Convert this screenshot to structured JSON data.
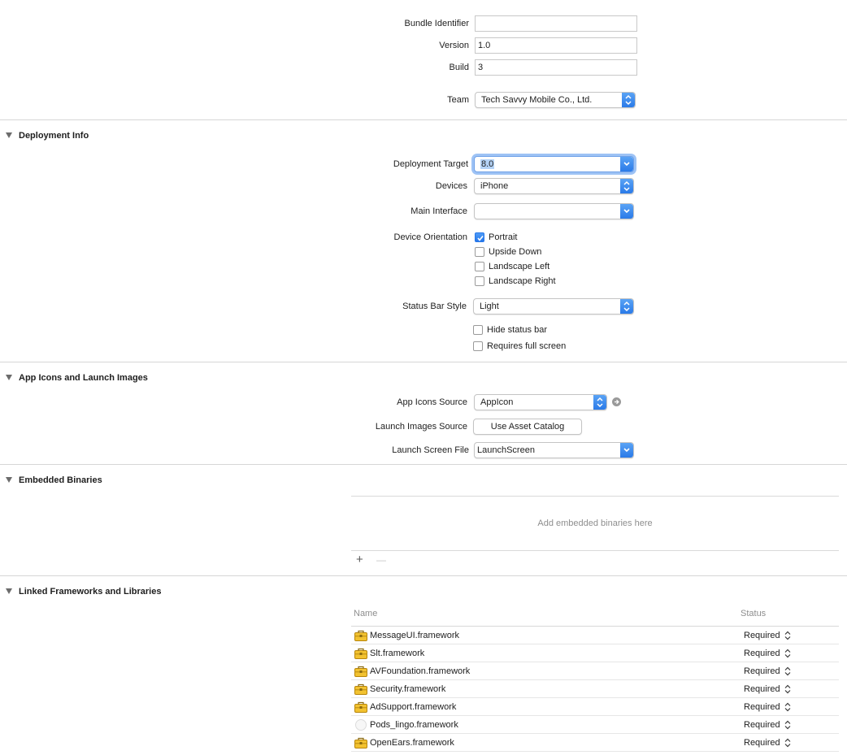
{
  "identity": {
    "bundle_identifier_label": "Bundle Identifier",
    "bundle_identifier_value": "",
    "version_label": "Version",
    "version_value": "1.0",
    "build_label": "Build",
    "build_value": "3"
  },
  "signing": {
    "team_label": "Team",
    "team_value": "Tech Savvy Mobile Co., Ltd."
  },
  "deployment": {
    "section_title": "Deployment Info",
    "target_label": "Deployment Target",
    "target_value": "8.0",
    "devices_label": "Devices",
    "devices_value": "iPhone",
    "main_interface_label": "Main Interface",
    "main_interface_value": "",
    "orientation_label": "Device Orientation",
    "orientations": [
      {
        "label": "Portrait",
        "checked": true
      },
      {
        "label": "Upside Down",
        "checked": false
      },
      {
        "label": "Landscape Left",
        "checked": false
      },
      {
        "label": "Landscape Right",
        "checked": false
      }
    ],
    "status_bar_style_label": "Status Bar Style",
    "status_bar_style_value": "Light",
    "hide_status_bar_label": "Hide status bar",
    "hide_status_bar_checked": false,
    "requires_full_screen_label": "Requires full screen",
    "requires_full_screen_checked": false
  },
  "app_icons": {
    "section_title": "App Icons and Launch Images",
    "icons_source_label": "App Icons Source",
    "icons_source_value": "AppIcon",
    "launch_images_label": "Launch Images Source",
    "launch_images_button": "Use Asset Catalog",
    "launch_screen_label": "Launch Screen File",
    "launch_screen_value": "LaunchScreen"
  },
  "embedded": {
    "section_title": "Embedded Binaries",
    "placeholder": "Add embedded binaries here",
    "add_symbol": "+",
    "remove_symbol": "—"
  },
  "linked": {
    "section_title": "Linked Frameworks and Libraries",
    "col_name": "Name",
    "col_status": "Status",
    "rows": [
      {
        "name": "MessageUI.framework",
        "status": "Required",
        "icon": "toolbox-icon"
      },
      {
        "name": "Slt.framework",
        "status": "Required",
        "icon": "toolbox-icon"
      },
      {
        "name": "AVFoundation.framework",
        "status": "Required",
        "icon": "toolbox-icon"
      },
      {
        "name": "Security.framework",
        "status": "Required",
        "icon": "toolbox-icon"
      },
      {
        "name": "AdSupport.framework",
        "status": "Required",
        "icon": "toolbox-icon"
      },
      {
        "name": "Pods_lingo.framework",
        "status": "Required",
        "icon": "blank-file-icon"
      },
      {
        "name": "OpenEars.framework",
        "status": "Required",
        "icon": "toolbox-icon"
      }
    ]
  },
  "colors": {
    "accent_blue": "#2a7ae8",
    "focus_ring": "#9ec3f5",
    "toolbox_yellow": "#f2c230"
  }
}
